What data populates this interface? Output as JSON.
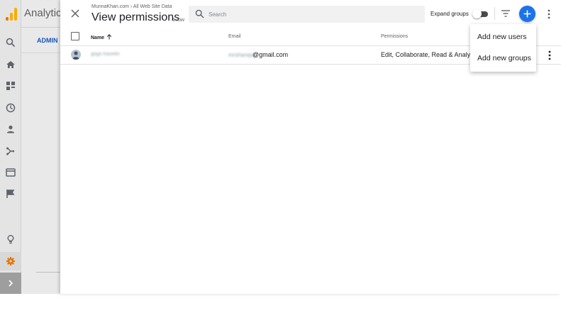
{
  "app": {
    "title": "Analytics",
    "tab_label": "ADMIN"
  },
  "dialog": {
    "breadcrumb": "MunnaKhan.com › All Web Site Data",
    "title": "View permissions",
    "row_count": "1 row"
  },
  "search": {
    "placeholder": "Search",
    "value": ""
  },
  "toolbar": {
    "expand_groups_label": "Expand groups",
    "expand_groups_on": false
  },
  "table": {
    "headers": {
      "name": "Name",
      "email": "Email",
      "permissions": "Permissions"
    },
    "rows": [
      {
        "name": "gogo traveler",
        "email_hidden": "mrshanqoi",
        "email_domain": "@gmail.com",
        "permissions": "Edit, Collaborate, Read & Analyze"
      }
    ]
  },
  "menu": {
    "items": [
      "Add new users",
      "Add new groups"
    ]
  },
  "colors": {
    "accent": "#1a73e8",
    "logo_orange": "#f9ab00",
    "logo_dark_orange": "#e37400",
    "admin_tab": "#1a56b8",
    "gear_active": "#e37400"
  }
}
